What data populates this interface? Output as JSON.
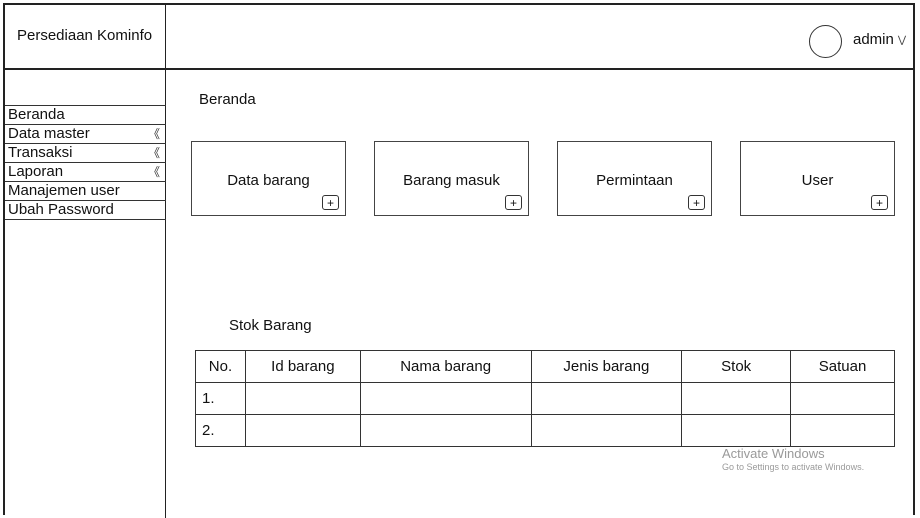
{
  "header": {
    "brand": "Persediaan Kominfo",
    "user_label": "admin"
  },
  "sidebar": {
    "items": [
      {
        "label": "Beranda",
        "arrow": ""
      },
      {
        "label": "Data master",
        "arrow": "《"
      },
      {
        "label": "Transaksi",
        "arrow": "《"
      },
      {
        "label": "Laporan",
        "arrow": "《"
      },
      {
        "label": "Manajemen user",
        "arrow": ""
      },
      {
        "label": "Ubah Password",
        "arrow": ""
      }
    ]
  },
  "main": {
    "title": "Beranda",
    "cards": [
      {
        "label": "Data barang",
        "plus": "+"
      },
      {
        "label": "Barang masuk",
        "plus": "+"
      },
      {
        "label": "Permintaan",
        "plus": "+"
      },
      {
        "label": "User",
        "plus": "+"
      }
    ],
    "stock": {
      "title": "Stok Barang",
      "columns": [
        "No.",
        "Id barang",
        "Nama barang",
        "Jenis barang",
        "Stok",
        "Satuan"
      ],
      "rows": [
        {
          "no": "1.",
          "id": "",
          "nama": "",
          "jenis": "",
          "stok": "",
          "satuan": ""
        },
        {
          "no": "2.",
          "id": "",
          "nama": "",
          "jenis": "",
          "stok": "",
          "satuan": ""
        }
      ]
    }
  },
  "watermark": {
    "line1": "Activate Windows",
    "line2": "Go to Settings to activate Windows."
  }
}
